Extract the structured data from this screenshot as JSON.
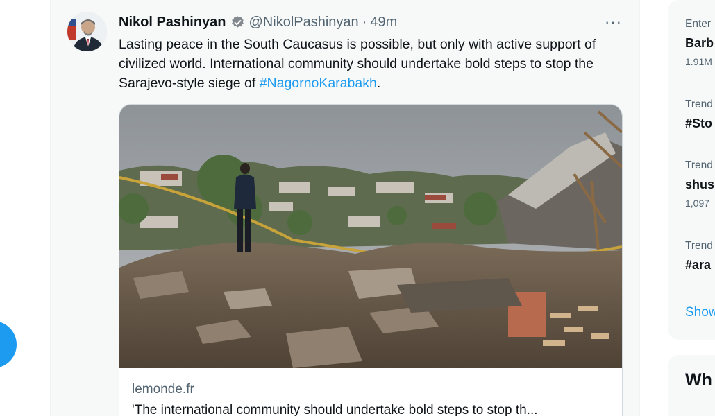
{
  "tweet": {
    "author_name": "Nikol Pashinyan",
    "handle": "@NikolPashinyan",
    "separator": "·",
    "time": "49m",
    "more_label": "···",
    "text_before": "Lasting peace in the South Caucasus is possible, but only with active support of civilized world. International community should undertake bold steps to stop the Sarajevo-style siege of ",
    "hashtag": "#NagornoKarabakh",
    "text_after": ".",
    "card": {
      "domain": "lemonde.fr",
      "title": "'The international community should undertake bold steps to stop th..."
    }
  },
  "sidebar": {
    "trends": [
      {
        "context": "Enter",
        "name": "Barb",
        "count": "1.91M"
      },
      {
        "context": "Trend",
        "name": "#Sto",
        "count": ""
      },
      {
        "context": "Trend",
        "name": "shus",
        "count": "1,097"
      },
      {
        "context": "Trend",
        "name": "#ara",
        "count": ""
      }
    ],
    "show_more": "Show",
    "whats_happening": "Wh"
  },
  "colors": {
    "accent": "#1d9bf0",
    "text": "#0f1419",
    "secondary": "#536471",
    "background": "#f7f9f9"
  }
}
